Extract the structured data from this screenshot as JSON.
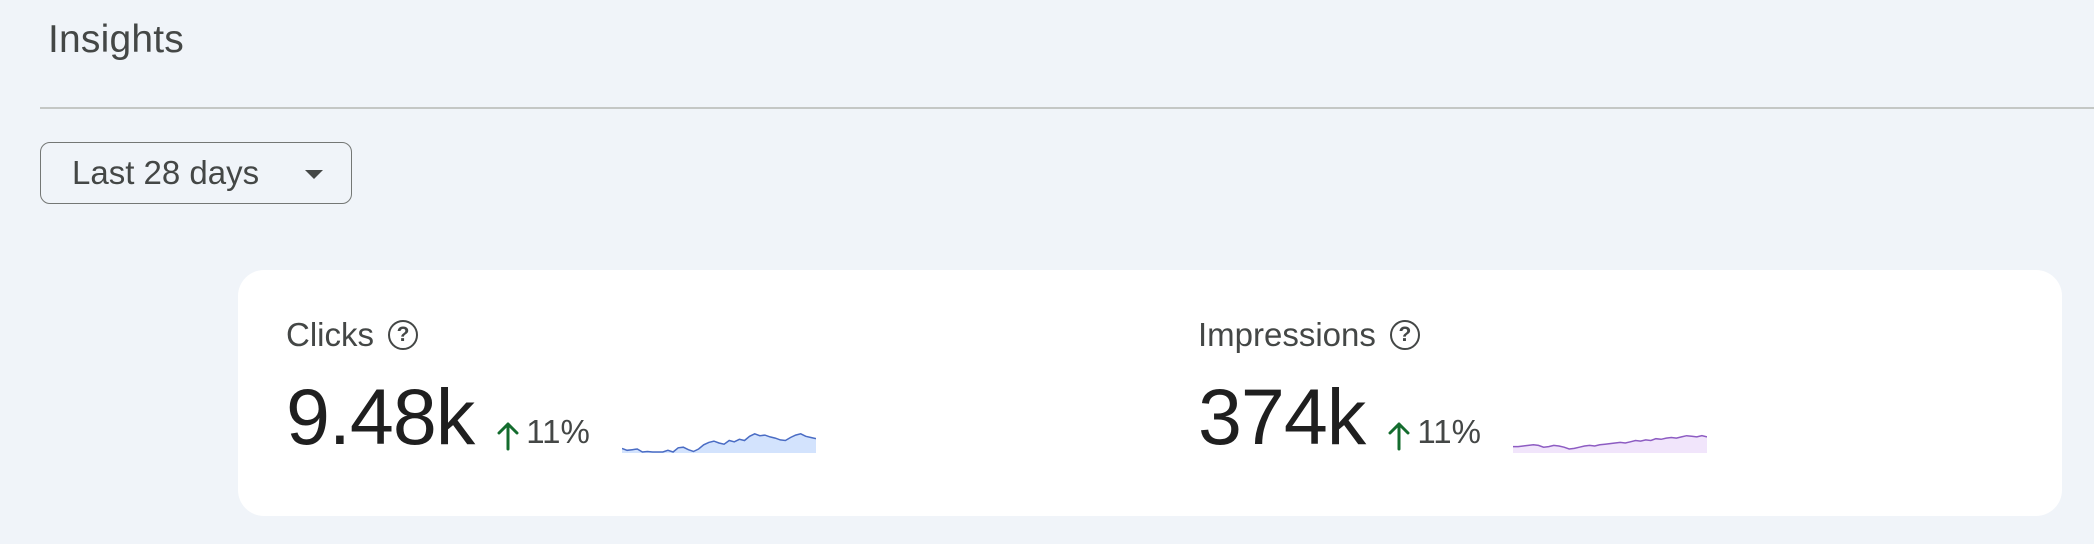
{
  "header": {
    "title": "Insights"
  },
  "filters": {
    "range_label": "Last 28 days"
  },
  "metrics": [
    {
      "name": "Clicks",
      "value": "9.48k",
      "delta": "11%",
      "trend": "up",
      "sparkline_color": "#4a6cc4",
      "sparkline_fill": "#d3e3fd",
      "sparkline": [
        45,
        42,
        43,
        44,
        39,
        40,
        38,
        35,
        36,
        42,
        38,
        46,
        47,
        43,
        40,
        44,
        51,
        55,
        57,
        54,
        52,
        58,
        56,
        60,
        58,
        65,
        69,
        66,
        67,
        64,
        62,
        59,
        58,
        63,
        67,
        69,
        65,
        63,
        61
      ]
    },
    {
      "name": "Impressions",
      "value": "374k",
      "delta": "11%",
      "trend": "up",
      "sparkline_color": "#8d5cc2",
      "sparkline_fill": "#f1e5fb",
      "sparkline": [
        48,
        48,
        49,
        50,
        51,
        50,
        47,
        48,
        50,
        49,
        47,
        44,
        45,
        47,
        49,
        50,
        49,
        51,
        52,
        53,
        54,
        55,
        54,
        56,
        58,
        57,
        59,
        58,
        61,
        60,
        62,
        63,
        62,
        64,
        66,
        65,
        64,
        66,
        64
      ]
    }
  ],
  "colors": {
    "delta_up": "#146c2e"
  }
}
